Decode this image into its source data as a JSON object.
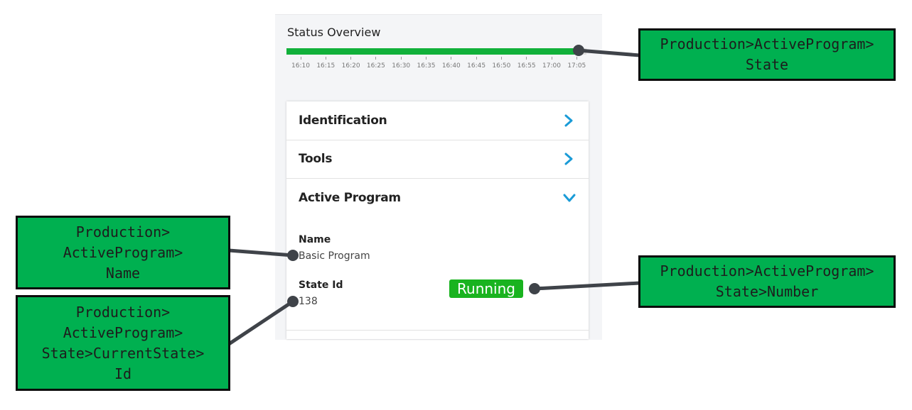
{
  "status_overview": {
    "title": "Status Overview",
    "progress_fraction": 0.98,
    "bar_color": "#11b03a",
    "ticks": [
      "16:10",
      "16:15",
      "16:20",
      "16:25",
      "16:30",
      "16:35",
      "16:40",
      "16:45",
      "16:50",
      "16:55",
      "17:00",
      "17:05"
    ]
  },
  "card": {
    "rows": [
      {
        "label": "Identification",
        "icon": "chevron-right-icon"
      },
      {
        "label": "Tools",
        "icon": "chevron-right-icon"
      },
      {
        "label": "Active Program",
        "icon": "chevron-down-icon"
      }
    ],
    "name_label": "Name",
    "name_value": "Basic Program",
    "state_id_label": "State Id",
    "state_id_value": "138",
    "status_badge": "Running",
    "badge_color": "#19b31f",
    "accent_color": "#1a9bd7"
  },
  "callouts": {
    "state": "Production>ActiveProgram>\nState",
    "name": "Production>\nActiveProgram>\nName",
    "number": "Production>ActiveProgram>\nState>Number",
    "id": "Production>\nActiveProgram>\nState>CurrentState>\nId",
    "callout_color": "#00b050"
  }
}
